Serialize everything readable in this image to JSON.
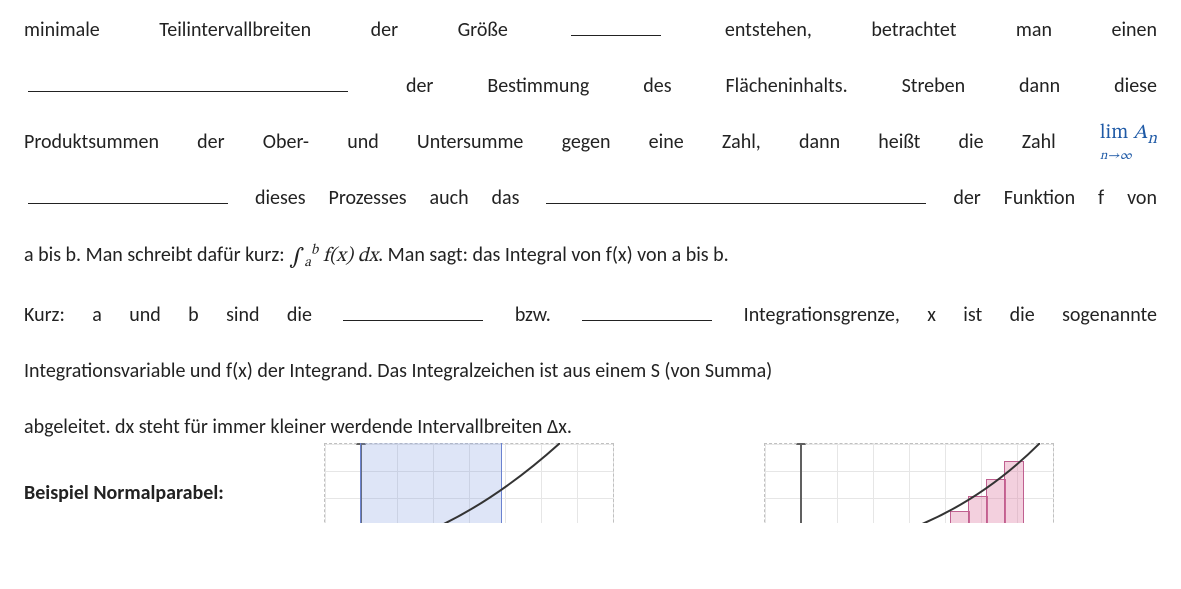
{
  "para1": {
    "t1": "minimale",
    "t2": "Teilintervallbreiten",
    "t3": "der",
    "t4": "Größe",
    "t5": "entstehen,",
    "t6": "betrachtet",
    "t7": "man",
    "t8": "einen"
  },
  "para2": {
    "t1": "der",
    "t2": "Bestimmung",
    "t3": "des",
    "t4": "Flächeninhalts.",
    "t5": "Streben",
    "t6": "dann",
    "t7": "diese"
  },
  "para3": {
    "t1": "Produktsummen",
    "t2": "der",
    "t3": "Ober-",
    "t4": "und",
    "t5": "Untersumme",
    "t6": "gegen",
    "t7": "eine",
    "t8": "Zahl,",
    "t9": "dann",
    "t10": "heißt",
    "t11": "die",
    "t12": "Zahl"
  },
  "limit": {
    "lim": "lim",
    "An": "A",
    "An_sub": "n",
    "below": "n→∞"
  },
  "para4": {
    "t1": "dieses Prozesses auch das",
    "t2": "der Funktion f von"
  },
  "para5": {
    "prefix": "a bis b. Man schreibt dafür kurz: ",
    "suffix": ". Man sagt: das Integral von f(x) von a bis b."
  },
  "integral": {
    "sym": "∫",
    "a": "a",
    "b": "b",
    "fx": "f(x)",
    "dx": "dx"
  },
  "para6": {
    "t1": "Kurz: a und b sind die",
    "t2": "bzw.",
    "t3": "Integrationsgrenze, x ist die sogenannte"
  },
  "para7": "Integrationsvariable und f(x) der Integrand. Das Integralzeichen ist aus einem S (von Summa)",
  "para8": "abgeleitet. dx steht für immer kleiner werdende Intervallbreiten Δx.",
  "heading": "Beispiel Normalparabel:"
}
